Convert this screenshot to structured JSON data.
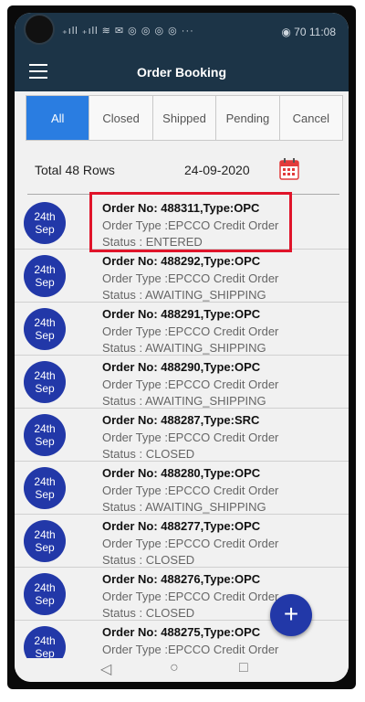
{
  "status_bar": {
    "left": "₊ıll ₊ıll ≋ ✉ ◎ ◎ ◎ ◎ ···",
    "right": "◉ 70 11:08"
  },
  "app_bar": {
    "title": "Order Booking"
  },
  "tabs": [
    {
      "label": "All",
      "active": true
    },
    {
      "label": "Closed"
    },
    {
      "label": "Shipped"
    },
    {
      "label": "Pending"
    },
    {
      "label": "Cancel"
    }
  ],
  "summary": {
    "total": "Total 48 Rows",
    "date": "24-09-2020"
  },
  "orders": [
    {
      "day": "24th",
      "month": "Sep",
      "order": "Order No: 488311,Type:OPC",
      "type": "Order Type :EPCCO Credit Order",
      "status": "Status : ENTERED"
    },
    {
      "day": "24th",
      "month": "Sep",
      "order": "Order No: 488292,Type:OPC",
      "type": "Order Type :EPCCO Credit Order",
      "status": "Status : AWAITING_SHIPPING"
    },
    {
      "day": "24th",
      "month": "Sep",
      "order": "Order No: 488291,Type:OPC",
      "type": "Order Type :EPCCO Credit Order",
      "status": "Status : AWAITING_SHIPPING"
    },
    {
      "day": "24th",
      "month": "Sep",
      "order": "Order No: 488290,Type:OPC",
      "type": "Order Type :EPCCO Credit Order",
      "status": "Status : AWAITING_SHIPPING"
    },
    {
      "day": "24th",
      "month": "Sep",
      "order": "Order No: 488287,Type:SRC",
      "type": "Order Type :EPCCO Credit Order",
      "status": "Status : CLOSED"
    },
    {
      "day": "24th",
      "month": "Sep",
      "order": "Order No: 488280,Type:OPC",
      "type": "Order Type :EPCCO Credit Order",
      "status": "Status : AWAITING_SHIPPING"
    },
    {
      "day": "24th",
      "month": "Sep",
      "order": "Order No: 488277,Type:OPC",
      "type": "Order Type :EPCCO Credit Order",
      "status": "Status : CLOSED"
    },
    {
      "day": "24th",
      "month": "Sep",
      "order": "Order No: 488276,Type:OPC",
      "type": "Order Type :EPCCO Credit Order",
      "status": "Status : CLOSED"
    },
    {
      "day": "24th",
      "month": "Sep",
      "order": "Order No: 488275,Type:OPC",
      "type": "Order Type :EPCCO Credit Order",
      "status": ""
    }
  ],
  "fab": {
    "label": "+"
  },
  "nav": {
    "back": "◁",
    "home": "○",
    "recent": "□"
  },
  "colors": {
    "app_bar": "#1c3447",
    "accent": "#2a7de1",
    "badge": "#2238a8",
    "highlight": "#e0142a"
  }
}
